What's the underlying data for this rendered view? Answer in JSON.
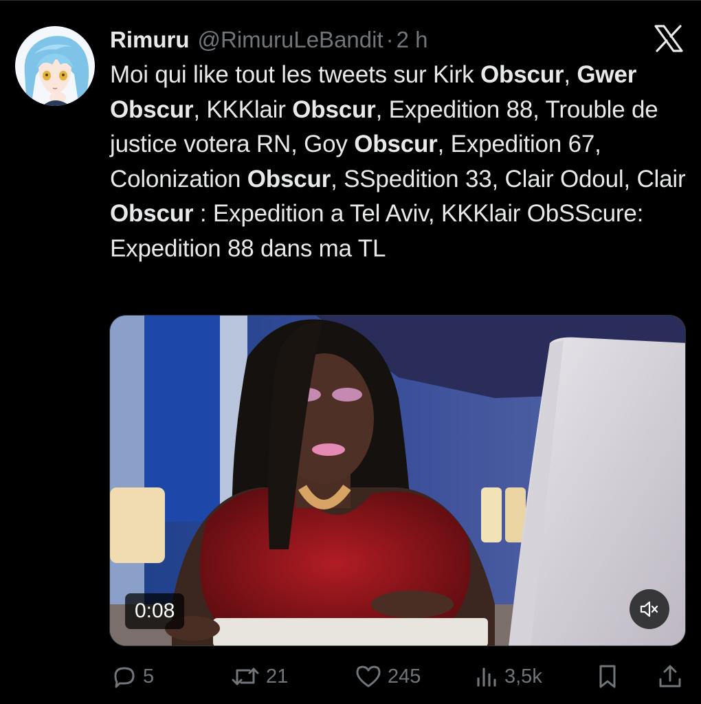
{
  "tweet": {
    "author": {
      "display_name": "Rimuru",
      "handle": "@RimuruLeBandit",
      "separator": "·",
      "time": "2 h"
    },
    "text_segments": [
      {
        "text": "Moi qui like tout les tweets sur Kirk ",
        "bold": false
      },
      {
        "text": "Obscur",
        "bold": true
      },
      {
        "text": ", ",
        "bold": false
      },
      {
        "text": "Gwer Obscur",
        "bold": true
      },
      {
        "text": ", KKKlair ",
        "bold": false
      },
      {
        "text": "Obscur",
        "bold": true
      },
      {
        "text": ", Expedition 88, Trouble de justice votera RN, Goy ",
        "bold": false
      },
      {
        "text": "Obscur",
        "bold": true
      },
      {
        "text": ", Expedition 67, Colonization ",
        "bold": false
      },
      {
        "text": "Obscur",
        "bold": true
      },
      {
        "text": ", SSpedition 33, Clair Odoul, Clair ",
        "bold": false
      },
      {
        "text": "Obscur",
        "bold": true
      },
      {
        "text": " : Expedition a Tel Aviv, KKKlair ObSScure: Expedition 88 dans ma TL",
        "bold": false
      }
    ],
    "media": {
      "duration": "0:08",
      "mute_icon": "speaker-muted-icon"
    },
    "actions": {
      "replies": {
        "icon": "reply-icon",
        "count": "5"
      },
      "reposts": {
        "icon": "repost-icon",
        "count": "21"
      },
      "likes": {
        "icon": "heart-icon",
        "count": "245"
      },
      "views": {
        "icon": "views-icon",
        "count": "3,5k"
      },
      "bookmark": {
        "icon": "bookmark-icon"
      },
      "share": {
        "icon": "share-icon"
      }
    }
  },
  "colors": {
    "background": "#000000",
    "text_primary": "#e7e9ea",
    "text_secondary": "#71767b",
    "divider": "#2f3336"
  }
}
